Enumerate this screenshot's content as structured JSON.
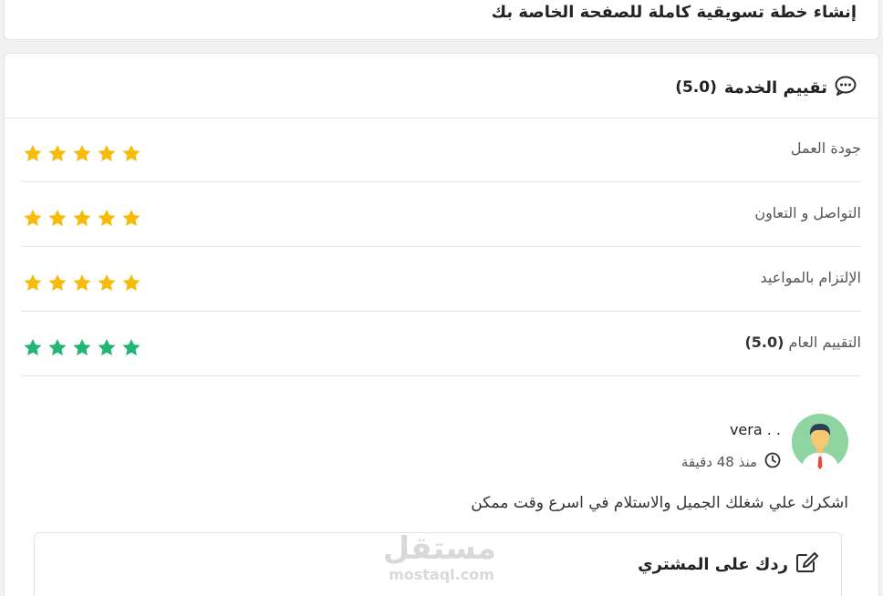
{
  "top_card": {
    "title": "إنشاء خطة تسويقية كاملة للصفحة الخاصة بك"
  },
  "rating_card": {
    "title": "تقييم الخدمة",
    "score": "(5.0)",
    "rows": [
      {
        "label": "جودة العمل",
        "score": "",
        "stars": 5,
        "color": "#f7bb09"
      },
      {
        "label": "التواصل و التعاون",
        "score": "",
        "stars": 5,
        "color": "#f7bb09"
      },
      {
        "label": "الإلتزام بالمواعيد",
        "score": "",
        "stars": 5,
        "color": "#f7bb09"
      },
      {
        "label": "التقييم العام",
        "score": "(5.0)",
        "stars": 5,
        "color": "#22b573"
      }
    ]
  },
  "review": {
    "reviewer": "vera . .",
    "time": "منذ 48 دقيقة",
    "comment": "اشكرك علي شغلك الجميل والاستلام في اسرع وقت ممكن"
  },
  "reply": {
    "title": "ردك على المشتري"
  },
  "watermark": {
    "ar": "مستقل",
    "en": "mostaql.com"
  },
  "icons": {
    "head_icon": "chat-bubble-icon",
    "time_icon": "clock-icon",
    "reply_icon": "edit-icon"
  }
}
